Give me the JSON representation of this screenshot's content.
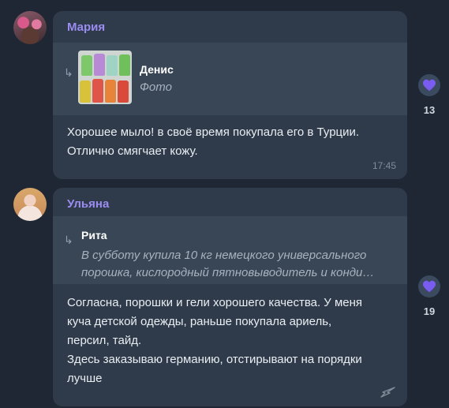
{
  "messages": [
    {
      "sender": "Мария",
      "reply": {
        "name": "Денис",
        "subtitle": "Фото"
      },
      "text": "Хорошее мыло! в своё время покупала его в Турции. Отлично смягчает кожу.",
      "time": "17:45",
      "likes": "13"
    },
    {
      "sender": "Ульяна",
      "reply": {
        "name": "Рита",
        "subtitle": "В субботу купила 10 кг немецкого универсального порошка, кислородный пятновыводитель и конди…"
      },
      "text_lines": [
        "Согласна, порошки и гели хорошего качества. У меня",
        "куча детской одежды, раньше покупала ариель,",
        "персил, тайд.",
        "Здесь заказываю германию, отстирывают на порядки",
        "лучше"
      ],
      "likes": "19"
    }
  ],
  "colors": {
    "background": "#1e2733",
    "bubble": "#2f3b4a",
    "reply": "#394656",
    "sender": "#9b8cf0",
    "heart": "#7a5cf0"
  }
}
